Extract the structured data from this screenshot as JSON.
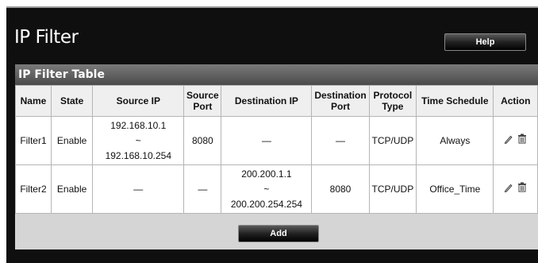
{
  "page": {
    "title": "IP Filter",
    "help_label": "Help"
  },
  "panel": {
    "title": "IP Filter Table"
  },
  "table": {
    "headers": {
      "name": "Name",
      "state": "State",
      "source_ip": "Source IP",
      "source_port_1": "Source",
      "source_port_2": "Port",
      "destination_ip": "Destination IP",
      "destination_port_1": "Destination",
      "destination_port_2": "Port",
      "protocol_1": "Protocol",
      "protocol_2": "Type",
      "time_schedule": "Time Schedule",
      "action": "Action"
    },
    "rows": [
      {
        "name": "Filter1",
        "state": "Enable",
        "source_ip_start": "192.168.10.1",
        "source_ip_sep": "~",
        "source_ip_end": "192.168.10.254",
        "source_port": "8080",
        "destination_ip": "—",
        "destination_port": "—",
        "protocol": "TCP/UDP",
        "time_schedule": "Always"
      },
      {
        "name": "Filter2",
        "state": "Enable",
        "source_ip": "—",
        "source_port": "—",
        "destination_ip_start": "200.200.1.1",
        "destination_ip_sep": "~",
        "destination_ip_end": "200.200.254.254",
        "destination_port": "8080",
        "protocol": "TCP/UDP",
        "time_schedule": "Office_Time"
      }
    ]
  },
  "footer": {
    "add_label": "Add"
  },
  "icons": {
    "edit": "pencil-icon",
    "delete": "trash-icon"
  }
}
